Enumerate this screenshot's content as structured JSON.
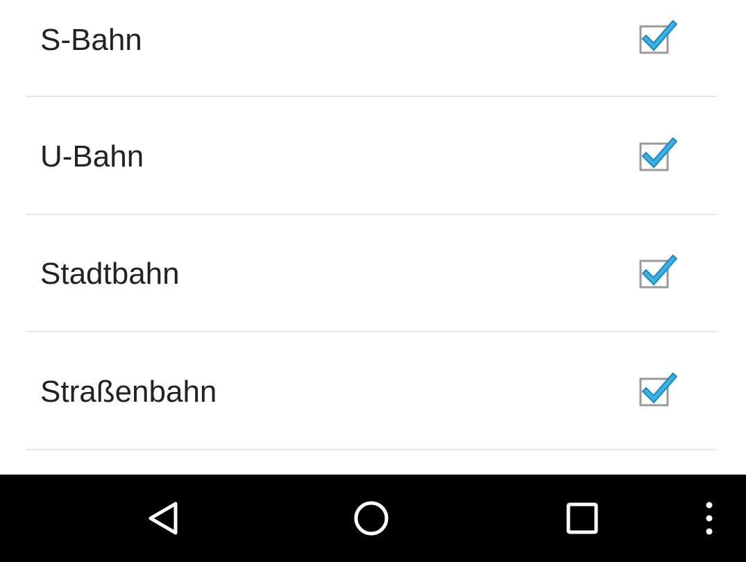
{
  "settings_list": {
    "items": [
      {
        "label": "S-Bahn",
        "checked": true
      },
      {
        "label": "U-Bahn",
        "checked": true
      },
      {
        "label": "Stadtbahn",
        "checked": true
      },
      {
        "label": "Straßenbahn",
        "checked": true
      }
    ]
  },
  "colors": {
    "check_accent": "#33b5e5",
    "divider": "#e6e6e6",
    "text": "#222222",
    "navbar": "#000000"
  },
  "navbar": {
    "icons": [
      "back-icon",
      "home-icon",
      "recents-icon",
      "overflow-menu-icon"
    ]
  }
}
